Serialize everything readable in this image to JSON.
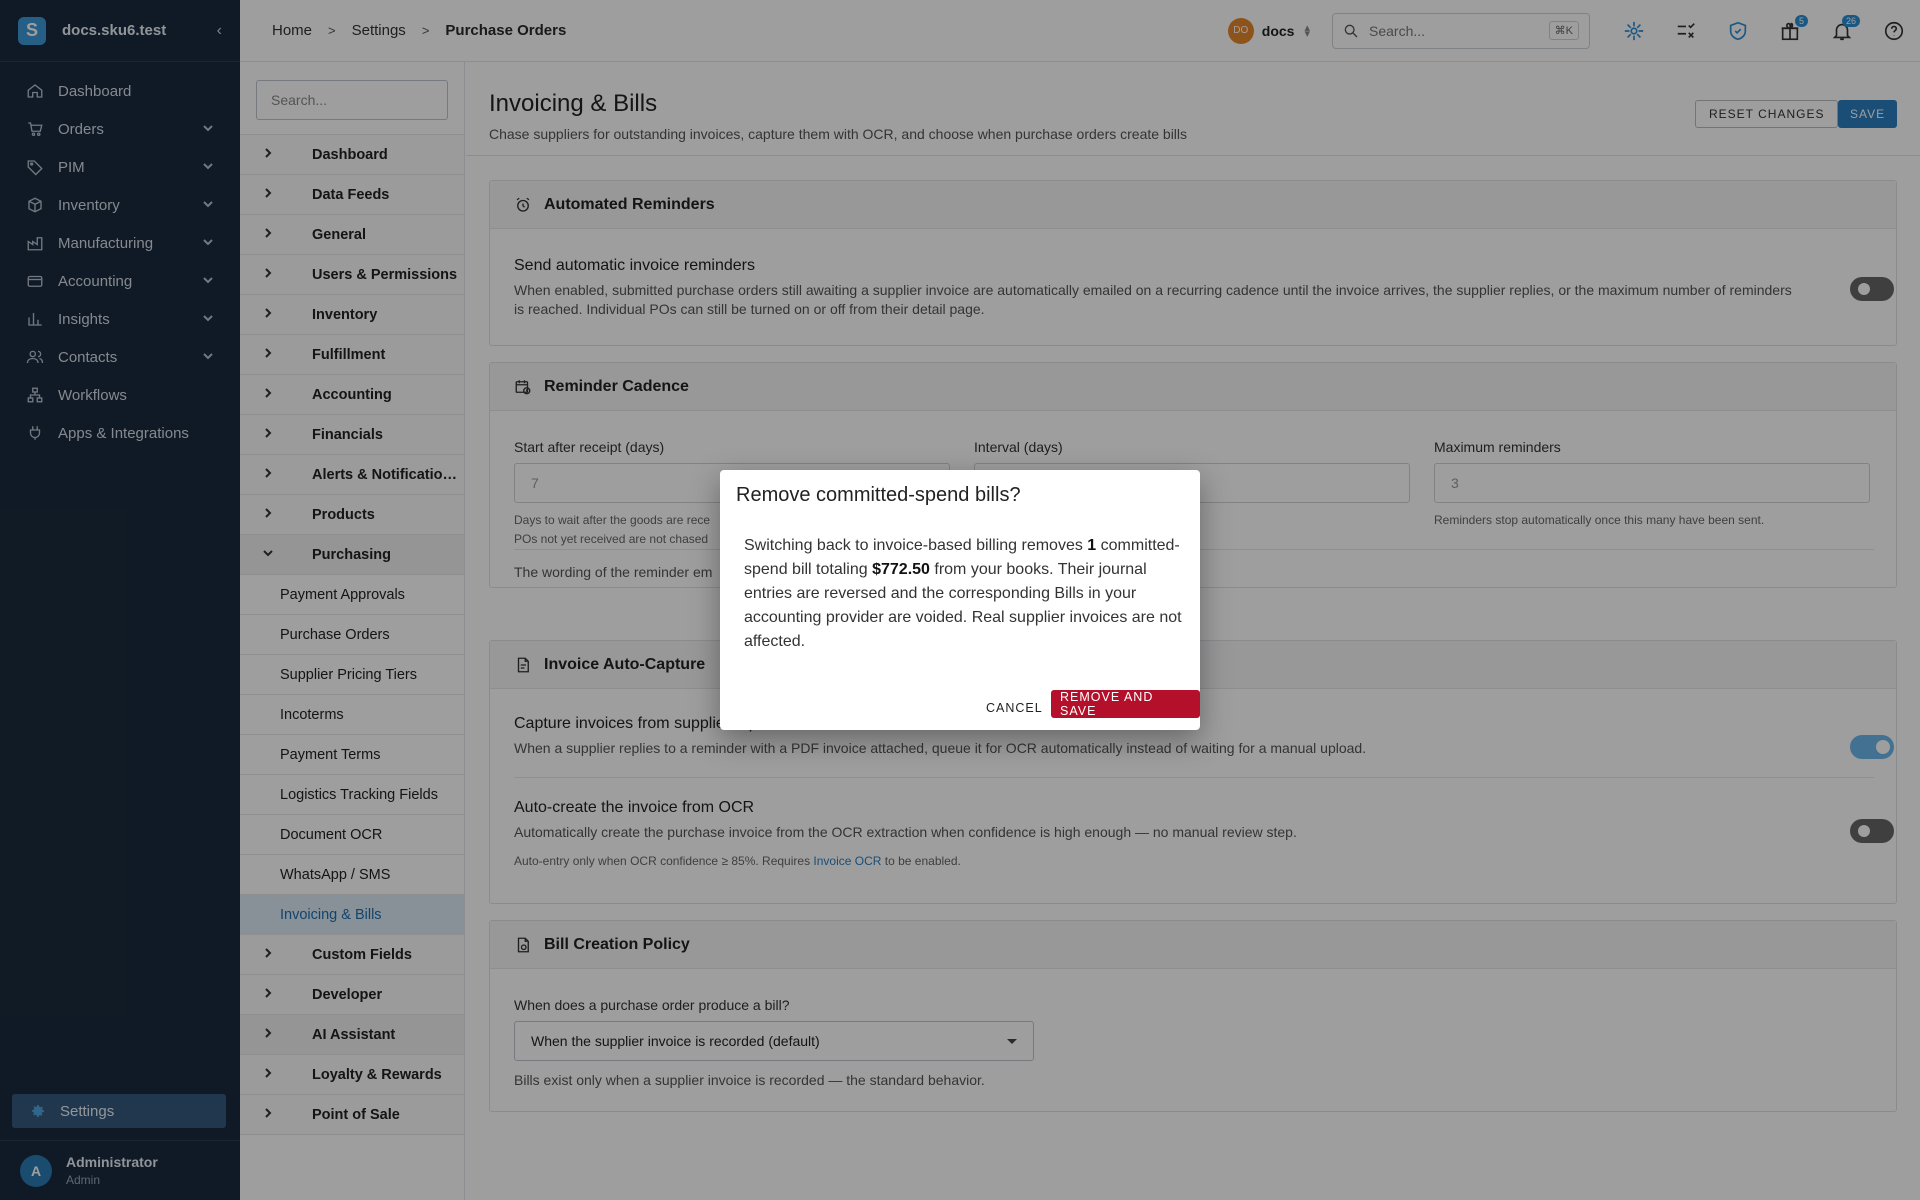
{
  "app": {
    "workspace": "docs.sku6.test",
    "logo_letter": "S",
    "collapse_glyph": "‹"
  },
  "sidebar": {
    "items": [
      {
        "label": "Dashboard",
        "icon": "home-icon"
      },
      {
        "label": "Orders",
        "icon": "cart-icon"
      },
      {
        "label": "PIM",
        "icon": "tag-icon"
      },
      {
        "label": "Inventory",
        "icon": "box-icon"
      },
      {
        "label": "Manufacturing",
        "icon": "factory-icon"
      },
      {
        "label": "Accounting",
        "icon": "bank-icon"
      },
      {
        "label": "Insights",
        "icon": "bar-chart-icon"
      },
      {
        "label": "Contacts",
        "icon": "people-icon"
      },
      {
        "label": "Workflows",
        "icon": "workflow-icon"
      },
      {
        "label": "Apps & Integrations",
        "icon": "plug-icon"
      }
    ],
    "settings_label": "Settings",
    "user": {
      "initial": "A",
      "name": "Administrator",
      "role": "Admin"
    }
  },
  "topbar": {
    "breadcrumbs": [
      "Home",
      "Settings",
      "Purchase Orders"
    ],
    "org_initials": "DO",
    "org_name": "docs",
    "search_placeholder": "Search...",
    "search_shortcut": "⌘K",
    "gifts_badge": "5",
    "notifications_badge": "26"
  },
  "settings_nav": {
    "search_placeholder": "Search...",
    "groups_top": [
      "Dashboard",
      "Data Feeds",
      "General",
      "Users & Permissions",
      "Inventory",
      "Fulfillment",
      "Accounting",
      "Financials",
      "Alerts & Notificatio…",
      "Products"
    ],
    "open_group": "Purchasing",
    "sub_items": [
      "Payment Approvals",
      "Purchase Orders",
      "Supplier Pricing Tiers",
      "Incoterms",
      "Payment Terms",
      "Logistics Tracking Fields",
      "Document OCR",
      "WhatsApp / SMS",
      "Invoicing & Bills"
    ],
    "groups_bottom": [
      "Custom Fields",
      "Developer",
      "AI Assistant",
      "Loyalty & Rewards",
      "Point of Sale"
    ]
  },
  "page": {
    "title": "Invoicing & Bills",
    "subtitle": "Chase suppliers for outstanding invoices, capture them with OCR, and choose when purchase orders create bills",
    "reset_label": "RESET CHANGES",
    "save_label": "SAVE"
  },
  "reminders": {
    "heading": "Automated Reminders",
    "title": "Send automatic invoice reminders",
    "desc": "When enabled, submitted purchase orders still awaiting a supplier invoice are automatically emailed on a recurring cadence until the invoice arrives, the supplier replies, or the maximum number of reminders is reached. Individual POs can still be turned on or off from their detail page.",
    "enabled": false
  },
  "cadence": {
    "heading": "Reminder Cadence",
    "start_label": "Start after receipt (days)",
    "start_value": "7",
    "start_help": "Days to wait after the goods are rece",
    "start_help2": "POs not yet received are not chased",
    "interval_label": "Interval (days)",
    "max_label": "Maximum reminders",
    "max_value": "3",
    "max_help": "Reminders stop automatically once this many have been sent.",
    "wording": "The wording of the reminder em"
  },
  "autocapture": {
    "heading": "Invoice Auto-Capture",
    "capture_title": "Capture invoices from supplier replies",
    "capture_desc": "When a supplier replies to a reminder with a PDF invoice attached, queue it for OCR automatically instead of waiting for a manual upload.",
    "capture_enabled": true,
    "auto_title": "Auto-create the invoice from OCR",
    "auto_desc": "Automatically create the purchase invoice from the OCR extraction when confidence is high enough — no manual review step.",
    "auto_enabled": false,
    "note_prefix": "Auto-entry only when OCR confidence ≥ 85%. Requires ",
    "note_link": "Invoice OCR",
    "note_suffix": " to be enabled."
  },
  "bill_policy": {
    "heading": "Bill Creation Policy",
    "question": "When does a purchase order produce a bill?",
    "selected": "When the supplier invoice is recorded (default)",
    "help": "Bills exist only when a supplier invoice is recorded — the standard behavior."
  },
  "dialog": {
    "title": "Remove committed-spend bills?",
    "body_1": "Switching back to invoice-based billing removes ",
    "count": "1",
    "body_2": " committed-spend bill totaling ",
    "amount": "$772.50",
    "body_3": " from your books. Their journal entries are reversed and the corresponding Bills in your accounting provider are voided. Real supplier invoices are not affected.",
    "cancel_label": "CANCEL",
    "confirm_label": "REMOVE AND SAVE"
  },
  "colors": {
    "sidebar_bg": "#1b2b3e",
    "accent": "#2b7fc0",
    "danger": "#b4102b",
    "org_badge": "#e5872a"
  }
}
